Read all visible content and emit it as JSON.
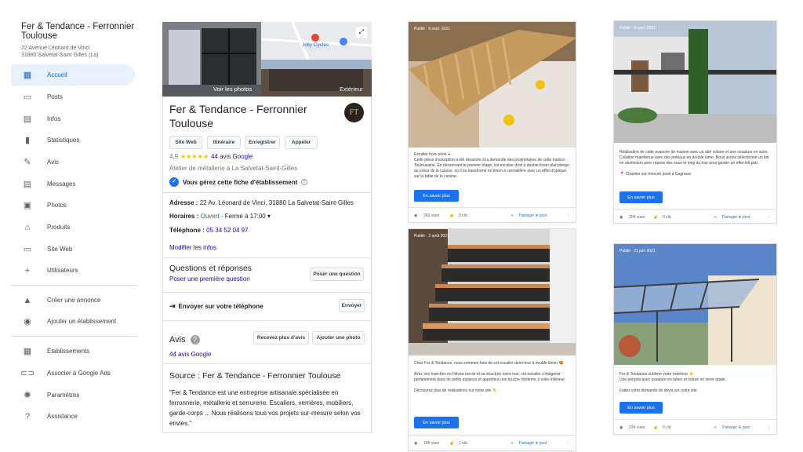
{
  "business": {
    "name": "Fer & Tendance - Ferronnier Toulouse",
    "address_line1": "22 Avenue Léonard de Vinci",
    "address_line2": "31880 Salvetat Saint Gilles (La)"
  },
  "nav": [
    {
      "label": "Accueil",
      "icon": "▦",
      "active": true
    },
    {
      "label": "Posts",
      "icon": "▭"
    },
    {
      "label": "Infos",
      "icon": "▤"
    },
    {
      "label": "Statistiques",
      "icon": "▮"
    },
    {
      "label": "Avis",
      "icon": "✎"
    },
    {
      "label": "Messages",
      "icon": "▤"
    },
    {
      "label": "Photos",
      "icon": "▣"
    },
    {
      "label": "Produits",
      "icon": "⌂"
    },
    {
      "label": "Site Web",
      "icon": "▭"
    },
    {
      "label": "Utilisateurs",
      "icon": "+"
    },
    {
      "label": "Créer une annonce",
      "icon": "▲"
    },
    {
      "label": "Ajouter un établissement",
      "icon": "◉"
    },
    {
      "label": "Établissements",
      "icon": "▦"
    },
    {
      "label": "Associer à Google Ads",
      "icon": "⊂⊃"
    },
    {
      "label": "Paramètres",
      "icon": "✺"
    },
    {
      "label": "Assistance",
      "icon": "?"
    }
  ],
  "panel": {
    "see_photos": "Voir les photos",
    "exterior": "Extérieur",
    "map_label": "Jolly Cycles",
    "title": "Fer & Tendance - Ferronnier Toulouse",
    "actions": [
      "Site Web",
      "Itinéraire",
      "Enregistrer",
      "Appeler"
    ],
    "rating": "4,9",
    "stars": "★★★★★",
    "reviews_link": "44 avis Google",
    "category": "Atelier de métallerie à La Salvetat-Saint-Gilles",
    "managed": "Vous gérez cette fiche d'établissement",
    "address_label": "Adresse :",
    "address_value": "22 Av. Léonard de Vinci, 31880 La Salvetat-Saint-Gilles",
    "hours_label": "Horaires :",
    "hours_open": "Ouvert",
    "hours_close": "· Ferme à 17:00 ▾",
    "phone_label": "Téléphone :",
    "phone_value": "05 34 52 04 97",
    "edit_info": "Modifier les infos",
    "qa_title": "Questions et réponses",
    "qa_link": "Poser une première question",
    "qa_button": "Poser une question",
    "send_phone": "Envoyer sur votre téléphone",
    "send_button": "Envoyer",
    "reviews_title": "Avis",
    "reviews_more": "Recevez plus d'avis",
    "add_photo": "Ajouter une photo",
    "reviews_count": "44 avis Google",
    "source_title": "Source : Fer & Tendance - Ferronnier Toulouse",
    "source_text": "\"Fer & Tendance est une entreprise artisanale spécialisée en ferronnerie, métallerie et serrurerie. Escaliers, verrières, mobiliers, garde-corps ... Nous réalisons tous vos projets sur-mesure selon vos envies.\""
  },
  "posts": [
    {
      "date": "Publié · 8 sept. 2021",
      "text": "Escalier hors-série ▪▪\nCette pièce d'exception a été dessinée à la demande des propriétaires de cette maison Toulousaine. En desservant le premier étage, cet escalier droit à double limon plat plonge au coeur de la cuisine, où il se transforme en limon à crémaillère avec un effet d'optique sur la table de la cuisine.",
      "button": "En savoir plus",
      "views": "260 vues",
      "clicks": "0 clic",
      "share": "Partager le post"
    },
    {
      "date": "Publié · 8 sept. 2021",
      "text": "Réalisation de cette avancée de maison avec un abri voiture et une ossature en acier. Création maintenue avec des poteaux en double lame. Nous avons sélectionné un toit en aluminium avec reprise des eaux le long du mur pour garder un effet toit plat.\n\n📍 Chantier sur-mesure posé à Cugnaux",
      "button": "En savoir plus",
      "views": "204 vues",
      "clicks": "0 clic",
      "share": "Partager le post"
    },
    {
      "date": "Publié · 2 août 2021",
      "text": "Chez Fer & Tendance, nous sommes fans de cet escalier demi-tour à double limon 😍\n\nAvec ses marches en Hévéa vernis et sa structure noire mat, cet escalier s'intégrera parfaitement dans de petits espaces et apportera une touche moderne à votre intérieur.\n\nDécouvrez plus de réalisations sur notre site 👇",
      "button": "En savoir plus",
      "views": "199 vues",
      "clicks": "1 clic",
      "share": "Partager le post"
    },
    {
      "date": "Publié · 21 juin 2021",
      "text": "Fer & Tendance sublime votre extérieur ☀️\nUne pergola avec ossature en tubes et toiture en verre opale.\n\nFaites votre demande de devis sur notre site",
      "button": "En savoir plus",
      "views": "234 vues",
      "clicks": "0 clic",
      "share": "Partager le post"
    }
  ],
  "colors": {
    "accent": "#1a73e8",
    "active_bg": "#e8f0fe",
    "star": "#fbbc04",
    "open": "#188038"
  }
}
